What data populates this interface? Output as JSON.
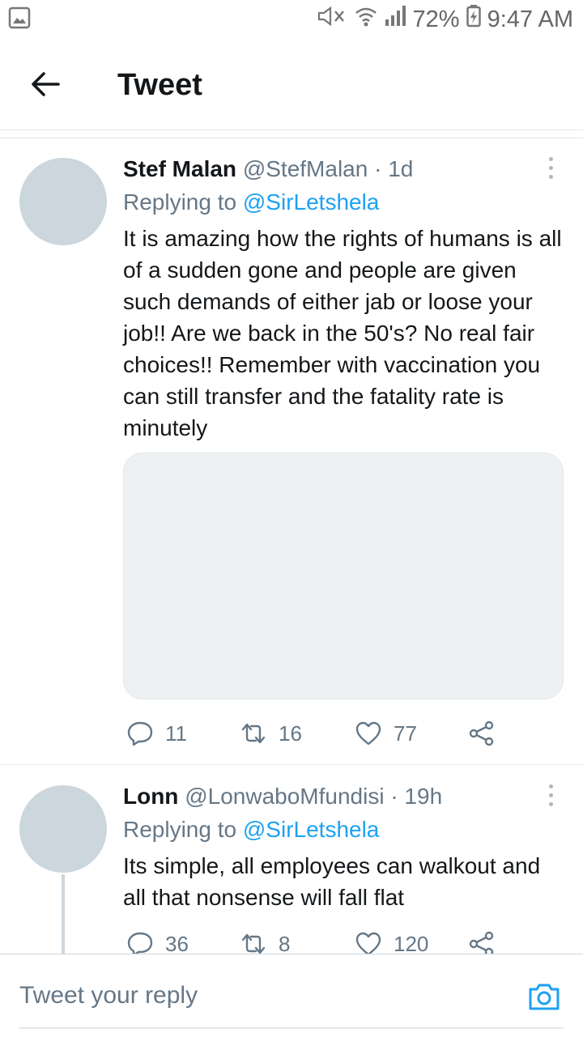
{
  "status_bar": {
    "battery": "72%",
    "time": "9:47 AM",
    "icons": [
      "gallery-icon",
      "mute-icon",
      "wifi-icon",
      "signal-icon",
      "battery-charging-icon"
    ]
  },
  "header": {
    "title": "Tweet",
    "back_icon": "arrow-left-icon"
  },
  "tweets": [
    {
      "name": "Stef Malan",
      "handle": "@StefMalan",
      "time": "· 1d",
      "replying_prefix": "Replying to",
      "replying_to": "@SirLetshela",
      "text": "It is amazing how the rights of humans is all of a sudden gone and people are given such demands of either jab or loose your job!! Are we back in the 50's? No real fair choices!! Remember with vaccination you can still transfer and the fatality rate is minutely",
      "replies": "11",
      "retweets": "16",
      "likes": "77"
    },
    {
      "name": "Lonn",
      "handle": "@LonwaboMfundisi",
      "time": "· 19h",
      "replying_prefix": "Replying to",
      "replying_to": "@SirLetshela",
      "text": "Its simple, all employees can walkout and all that nonsense will fall flat",
      "replies": "36",
      "retweets": "8",
      "likes": "120"
    }
  ],
  "reply_bar": {
    "placeholder": "Tweet your reply",
    "camera_icon": "camera-icon"
  },
  "colors": {
    "accent": "#1da1f2",
    "text": "#14171a",
    "secondary": "#657786",
    "avatar": "#ccd6dd",
    "media_bg": "#eef1f2"
  }
}
